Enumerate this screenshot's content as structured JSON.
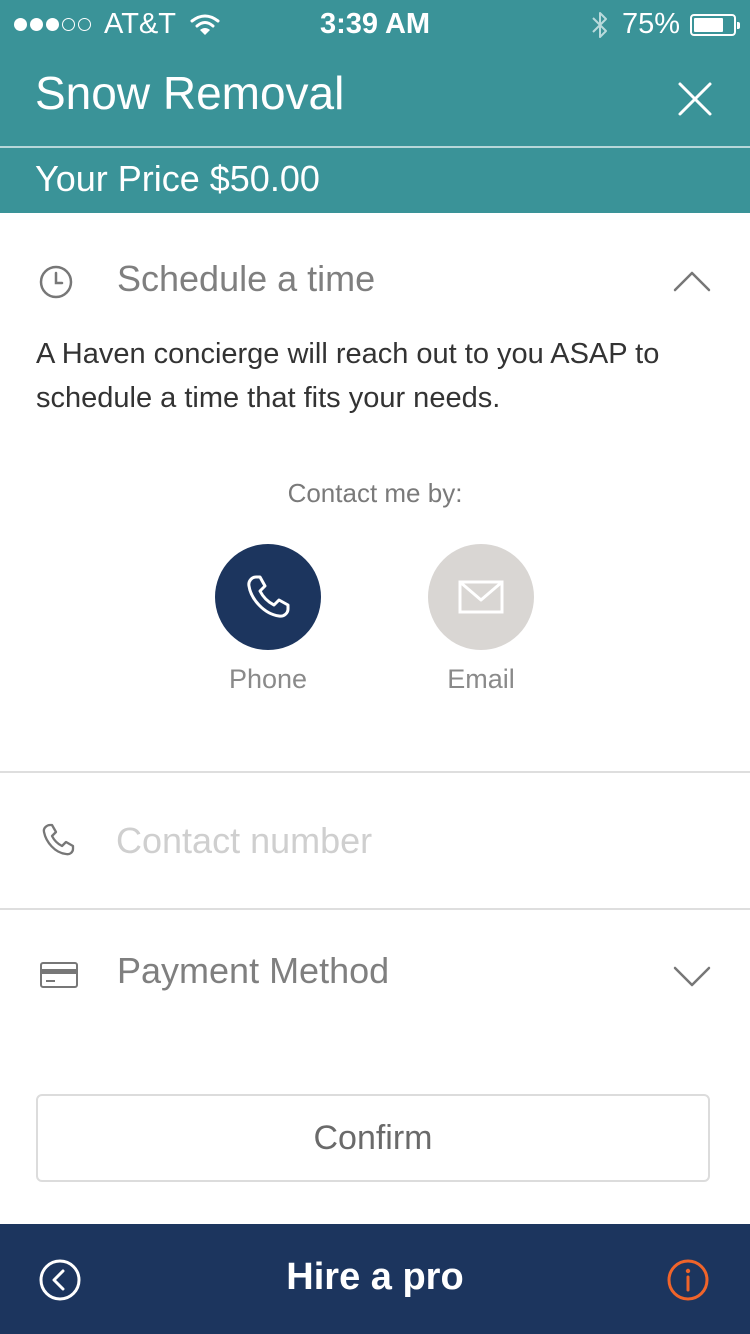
{
  "status_bar": {
    "carrier": "AT&T",
    "time": "3:39 AM",
    "battery": "75%",
    "battery_level": 0.75,
    "signal_bars_filled": 3,
    "signal_bars_total": 5
  },
  "header": {
    "title": "Snow Removal",
    "price": "Your Price $50.00"
  },
  "schedule": {
    "title": "Schedule a time",
    "description": "A Haven concierge will reach out to you ASAP to schedule a time that fits your needs.",
    "contact_label": "Contact me by:",
    "options": [
      {
        "label": "Phone",
        "selected": true
      },
      {
        "label": "Email",
        "selected": false
      }
    ]
  },
  "contact": {
    "placeholder": "Contact number",
    "value": ""
  },
  "payment": {
    "label": "Payment Method"
  },
  "confirm_label": "Confirm",
  "bottom_bar": {
    "title": "Hire a pro"
  },
  "colors": {
    "header": "#3a9398",
    "navy": "#1c355e",
    "info_accent": "#f0642a",
    "unselected": "#d9d6d3"
  },
  "icons": {
    "close": "close-icon",
    "clock": "clock-icon",
    "chevron_up": "chevron-up-icon",
    "phone_option": "phone-icon",
    "email_option": "envelope-icon",
    "contact_field": "phone-icon",
    "payment": "credit-card-icon",
    "chevron_down": "chevron-down-icon",
    "back": "back-arrow-icon",
    "info": "info-icon"
  }
}
